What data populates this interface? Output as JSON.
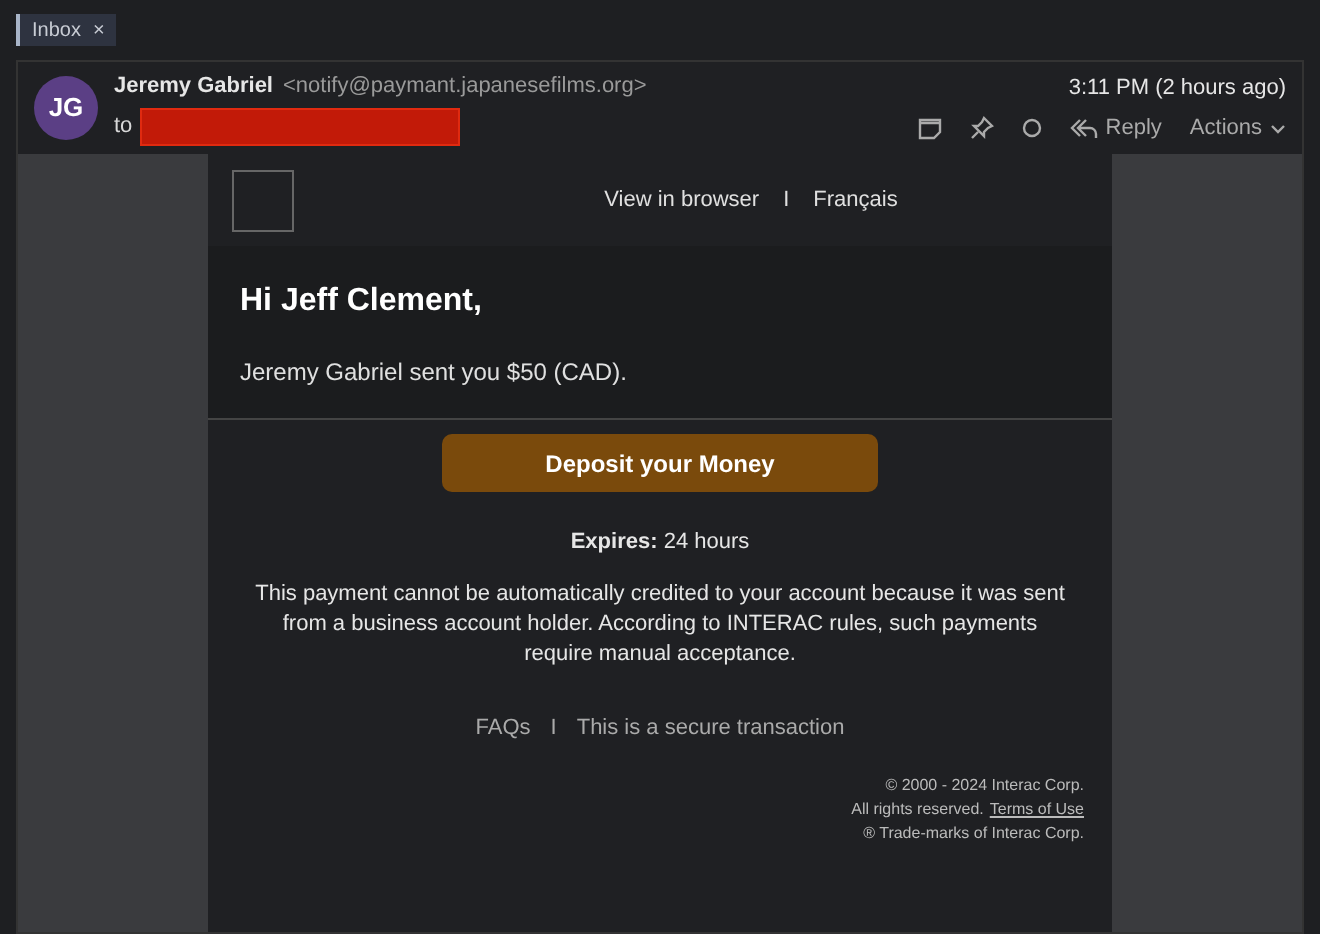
{
  "tag": {
    "label": "Inbox",
    "close": "×"
  },
  "message": {
    "avatar": "JG",
    "sender": "Jeremy Gabriel",
    "address": "<notify@paymant.japanesefilms.org>",
    "to_label": "to",
    "to_redacted": true,
    "time": "3:11 PM (2 hours ago)",
    "reply": "Reply",
    "actions": "Actions"
  },
  "email": {
    "links": [
      "View in browser",
      "Français"
    ],
    "separator": "I",
    "greeting": "Hi Jeff Clement,",
    "intro": "Jeremy Gabriel sent you $50 (CAD).",
    "button": "Deposit your Money",
    "expires": "**Expires:** 24 hours",
    "notice": "This payment cannot be automatically credited to your account because it was sent from a business account holder. According to INTERAC rules, such payments require manual acceptance.",
    "footer_links": [
      "FAQs",
      "This is a secure transaction"
    ],
    "footer_separator": "I",
    "copyright": "© 2000 - 2024 Interac Corp.",
    "rights": "All rights reserved.",
    "terms": "Terms of Use",
    "trademark": "® Trade-marks of Interac Corp."
  }
}
